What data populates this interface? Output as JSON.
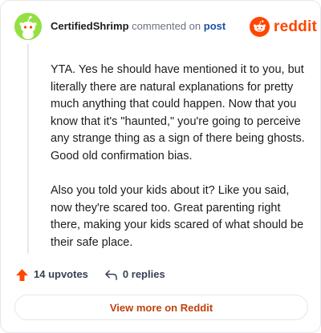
{
  "comment": {
    "username": "CertifiedShrimp",
    "action_text": "commented on",
    "post_link": "post",
    "avatar_color": "#94e044",
    "paragraphs": [
      "YTA. Yes he should have mentioned it to you, but literally there are natural explanations for pretty much anything that could happen. Now that you know that it's \"haunted,\" you're going to perceive any strange thing as a sign of there being ghosts. Good old confirmation bias.",
      "Also you told your kids about it? Like you said, now they're scared too. Great parenting right there, making your kids scared of what should be their safe place."
    ]
  },
  "brand": {
    "name": "reddit",
    "icon": "reddit-snoo-icon",
    "color": "#ff4500"
  },
  "actions": {
    "upvotes": "14 upvotes",
    "upvote_icon": "upvote-arrow-icon",
    "replies": "0 replies",
    "reply_icon": "reply-arrow-icon"
  },
  "footer": {
    "view_more": "View more on Reddit"
  },
  "colors": {
    "accent": "#ff4500",
    "link": "#1a4fa8",
    "view_more_text": "#c2410c"
  }
}
